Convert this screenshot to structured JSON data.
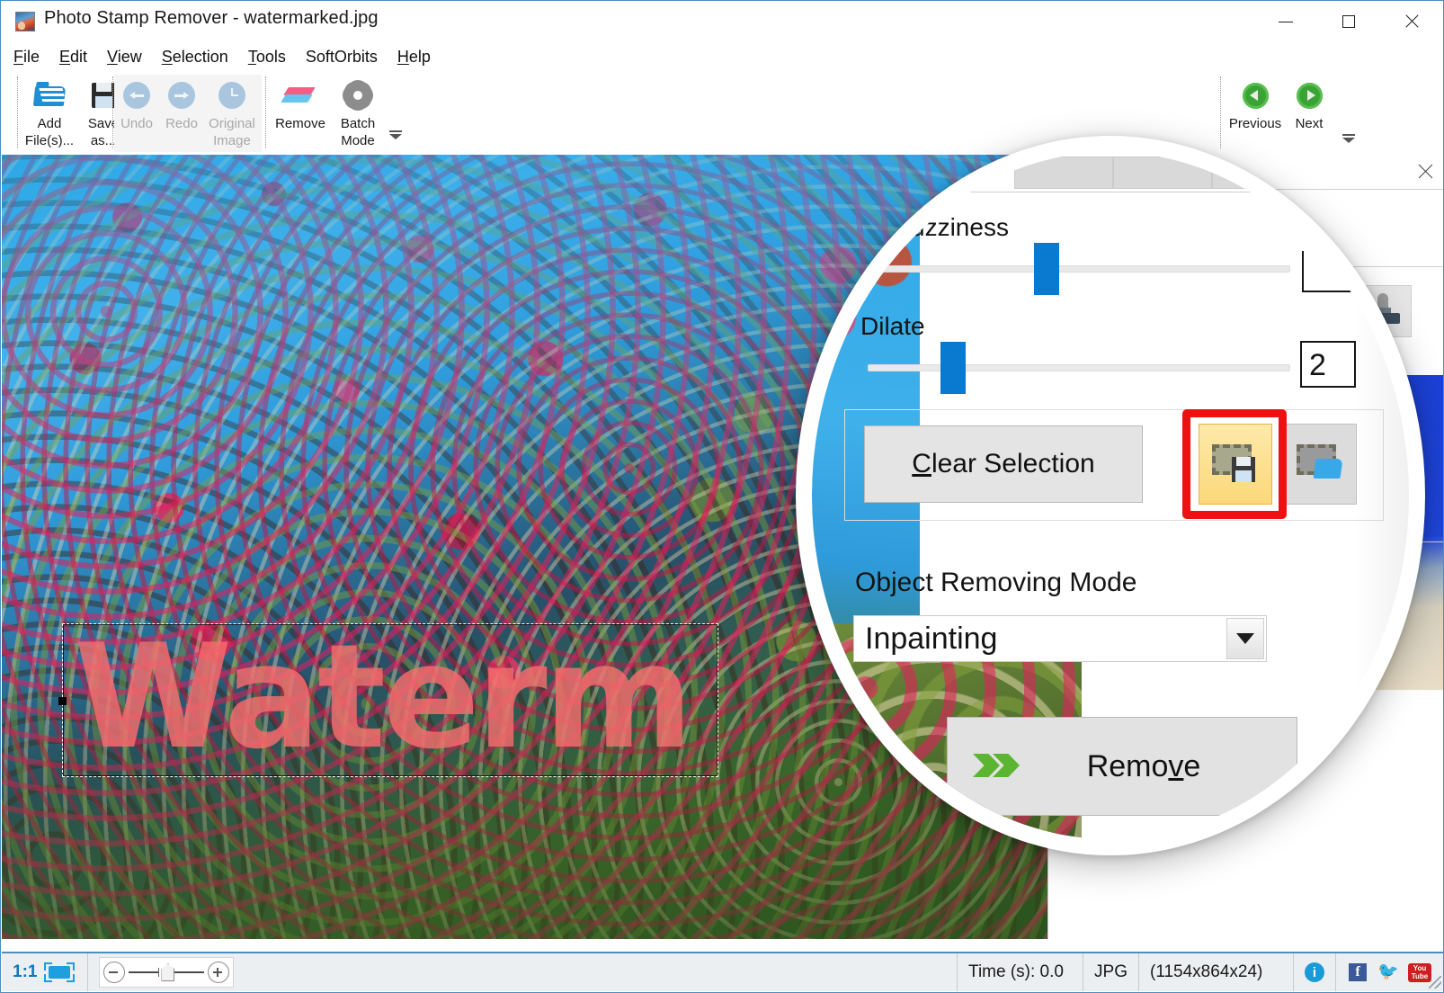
{
  "window": {
    "title": "Photo Stamp Remover - watermarked.jpg",
    "app_icon": "photo-app-icon",
    "minimize_label": "–",
    "maximize_label": "□",
    "close_label": "×"
  },
  "menu": [
    {
      "pre": "",
      "u": "F",
      "post": "ile"
    },
    {
      "pre": "",
      "u": "E",
      "post": "dit"
    },
    {
      "pre": "",
      "u": "V",
      "post": "iew"
    },
    {
      "pre": "",
      "u": "S",
      "post": "election"
    },
    {
      "pre": "",
      "u": "T",
      "post": "ools"
    },
    {
      "pre": "SoftOrbits",
      "u": "",
      "post": ""
    },
    {
      "pre": "",
      "u": "H",
      "post": "elp"
    }
  ],
  "ribbon": {
    "add_files": "Add\nFile(s)...",
    "save_as": "Save\nas...",
    "undo": "Undo",
    "redo": "Redo",
    "original_image": "Original\nImage",
    "remove": "Remove",
    "batch_mode": "Batch\nMode",
    "previous": "Previous",
    "next": "Next",
    "icons": {
      "add_files": "open-folder-icon",
      "save_as": "floppy-disk-icon",
      "undo": "undo-arrow-icon",
      "redo": "redo-arrow-icon",
      "original_image": "clock-history-icon",
      "remove": "eraser-icon",
      "batch_mode": "gear-icon",
      "previous": "green-left-arrow-icon",
      "next": "green-right-arrow-icon",
      "expander": "ribbon-expander-icon"
    }
  },
  "canvas": {
    "watermark_text": "Waterm",
    "watermark_color": "#f56e6e",
    "selection": "dashed-marquee"
  },
  "magnifier": {
    "color_fuzziness_label": "lor Fuzziness",
    "color_fuzziness_full_label": "Color Fuzziness",
    "dilate_label": "Dilate",
    "dilate_value": "2",
    "clear_selection": {
      "pre": "",
      "u": "C",
      "post": "lear Selection"
    },
    "save_selection_icon": "save-selection-icon",
    "load_selection_icon": "load-selection-icon",
    "highlight_color": "#ee1111",
    "object_removing_mode_label": "Object Removing Mode",
    "object_removing_mode_value": "Inpainting",
    "remove_button": {
      "pre": "Remo",
      "u": "v",
      "post": "e"
    },
    "remove_icon": "green-double-chevron-icon"
  },
  "right_panel": {
    "close_label": "×",
    "stamp_tool_icon": "stamp-tool-icon"
  },
  "statusbar": {
    "zoom_ratio": "1:1",
    "fit_icon": "fit-to-window-icon",
    "time": "Time (s): 0.0",
    "format": "JPG",
    "dimensions": "(1154x864x24)",
    "info_icon": "info-icon",
    "facebook_icon": "facebook-icon",
    "facebook_label": "f",
    "twitter_icon": "twitter-icon",
    "twitter_label": "🐦",
    "youtube_icon": "youtube-icon",
    "youtube_line1": "You",
    "youtube_line2": "Tube"
  }
}
